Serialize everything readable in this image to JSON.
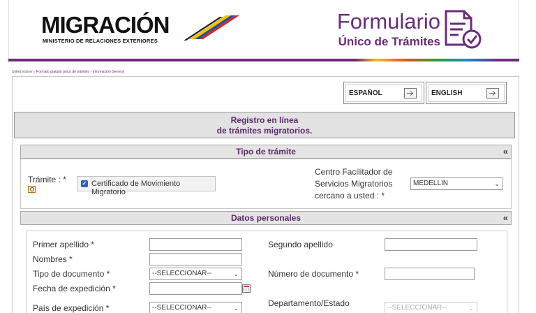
{
  "header": {
    "logo_word": "MIGRACIÓN",
    "logo_subtitle": "MINISTERIO DE RELACIONES EXTERIORES",
    "form_title_line1": "Formulario",
    "form_title_line2": "Único de Trámites"
  },
  "breadcrumb": {
    "prefix": "Usted está en : ",
    "path": "Formato gratuito único de trámites - Información General"
  },
  "languages": {
    "spanish": "ESPAÑOL",
    "english": "ENGLISH"
  },
  "banner": {
    "line1": "Registro en línea",
    "line2": "de trámites migratorios."
  },
  "tipo_tramite": {
    "title": "Tipo de trámite",
    "collapse": "«",
    "tramite_label": "Trámite : *",
    "tramite_option": "Certificado de Movimiento Migratorio",
    "centro_label_1": "Centro Facilitador de",
    "centro_label_2": "Servicios Migratorios",
    "centro_label_3": "cercano a usted : *",
    "centro_value": "MEDELLIN"
  },
  "datos_personales": {
    "title": "Datos personales",
    "collapse": "«",
    "primer_apellido": "Primer apellido *",
    "segundo_apellido": "Segundo apellido",
    "nombres": "Nombres *",
    "tipo_documento": "Tipo de documento *",
    "tipo_documento_value": "--SELECCIONAR--",
    "numero_documento": "Número de documento *",
    "fecha_expedicion": "Fecha de expedición *",
    "pais_expedicion": "País de expedición *",
    "pais_expedicion_value": "--SELECCIONAR--",
    "departamento": "Departamento/Estado",
    "departamento_value": "--SELECCIONAR--"
  },
  "colors": {
    "brand_purple": "#6b2b7a",
    "checkbox_blue": "#2a62b8"
  }
}
